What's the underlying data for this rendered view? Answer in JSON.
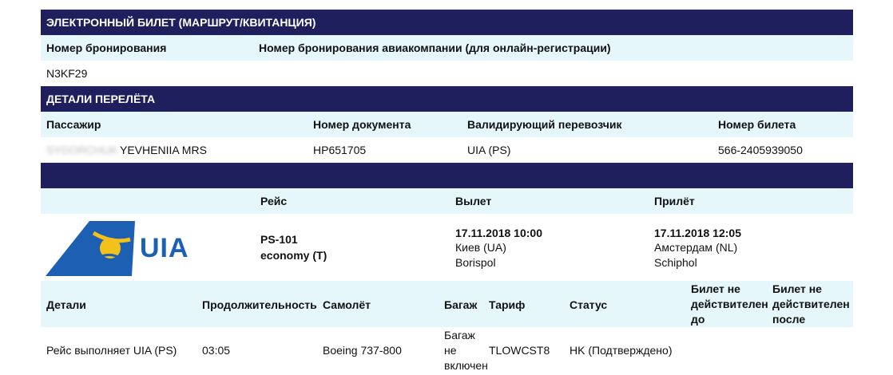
{
  "ticket_header": "ЭЛЕКТРОННЫЙ БИЛЕТ (МАРШРУТ/КВИТАНЦИЯ)",
  "booking": {
    "label_booking_no": "Номер бронирования",
    "label_airline_booking_no": "Номер бронирования авиакомпании (для онлайн-регистрации)",
    "booking_no": "N3KF29"
  },
  "flight_details_header": "ДЕТАЛИ ПЕРЕЛЁТА",
  "passenger": {
    "label_passenger": "Пассажир",
    "label_document": "Номер документа",
    "label_carrier": "Валидирующий перевозчик",
    "label_ticket": "Номер билета",
    "surname_blurred": "SYDORCHUK",
    "name": "YEVHENIIA MRS",
    "document": "HP651705",
    "carrier": "UIA (PS)",
    "ticket": "566-2405939050"
  },
  "segment": {
    "label_flight": "Рейс",
    "label_departure": "Вылет",
    "label_arrival": "Прилёт",
    "logo_text": "UIA",
    "flight_no": "PS-101",
    "cabin": "economy (T)",
    "dep_datetime": "17.11.2018 10:00",
    "dep_city": "Киев (UA)",
    "dep_airport": "Borispol",
    "arr_datetime": "17.11.2018 12:05",
    "arr_city": "Амстердам (NL)",
    "arr_airport": "Schiphol"
  },
  "details_table": {
    "headers": {
      "details": "Детали",
      "duration": "Продолжительность",
      "aircraft": "Самолёт",
      "baggage": "Багаж",
      "fare": "Тариф",
      "status": "Статус",
      "not_valid_before": "Билет не действителен до",
      "not_valid_after": "Билет не действителен после"
    },
    "row": {
      "details": "Рейс выполняет UIA (PS)",
      "duration": "03:05",
      "aircraft": "Boeing 737-800",
      "baggage": "Багаж не включен",
      "fare": "TLOWCST8",
      "status": "HK (Подтверждено)",
      "not_valid_before": "",
      "not_valid_after": ""
    }
  },
  "colors": {
    "header_bg": "#1f1f5e",
    "band_bg": "#e6f7fc",
    "logo_blue": "#1d5fb3",
    "logo_yellow": "#f2c21b"
  }
}
